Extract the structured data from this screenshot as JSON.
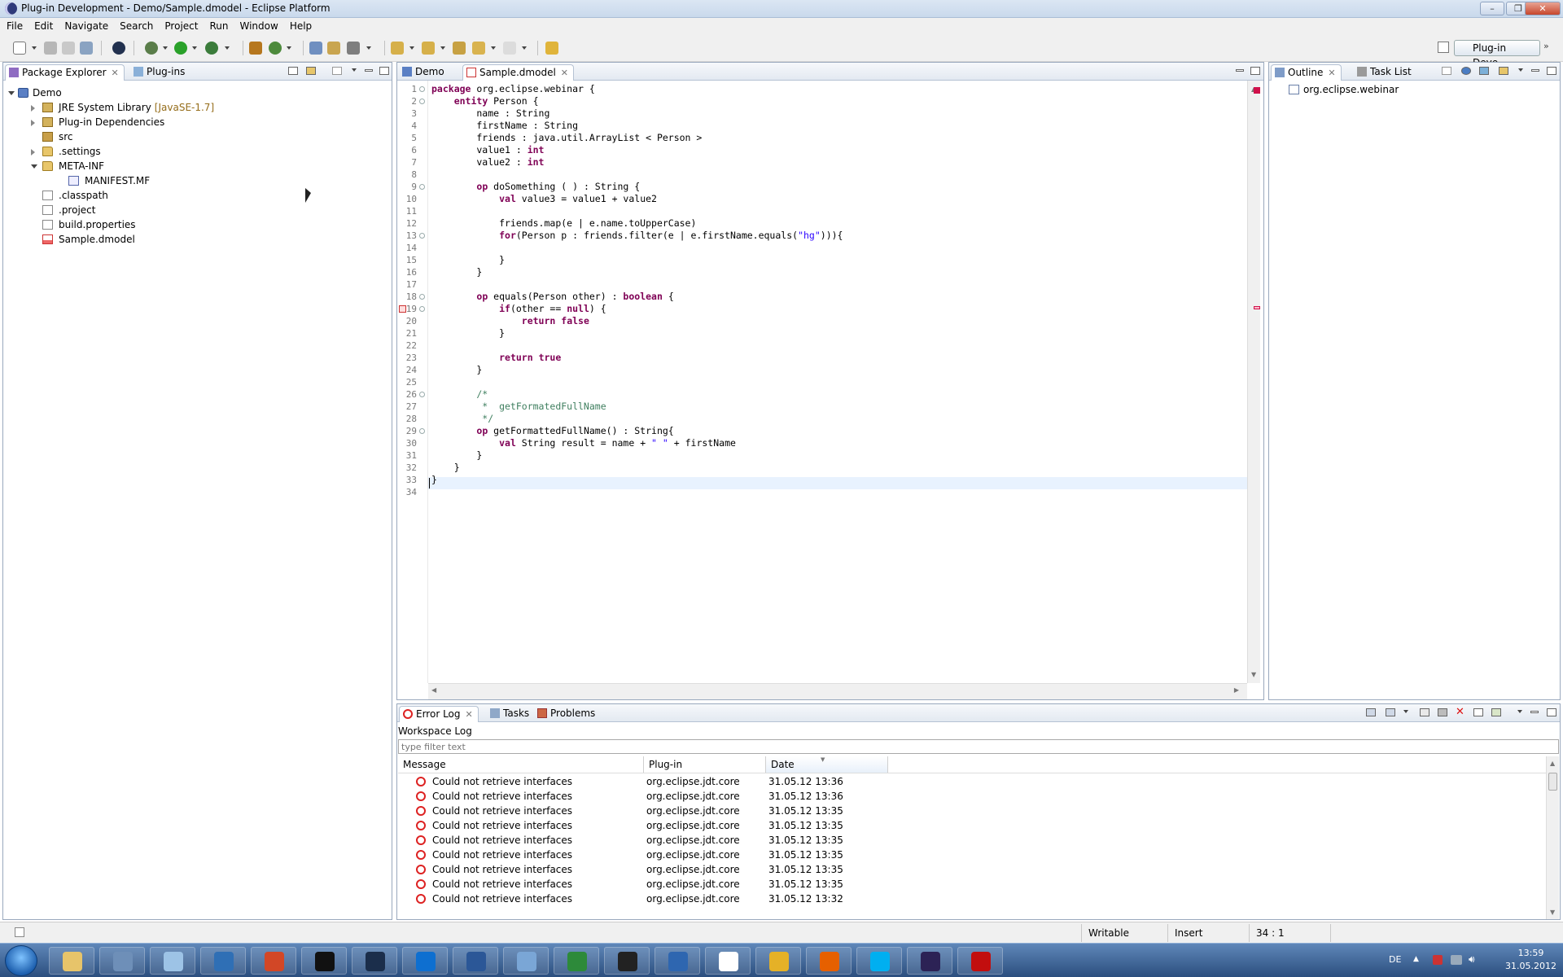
{
  "window": {
    "title": "Plug-in Development - Demo/Sample.dmodel - Eclipse Platform"
  },
  "menu": [
    "File",
    "Edit",
    "Navigate",
    "Search",
    "Project",
    "Run",
    "Window",
    "Help"
  ],
  "perspective": {
    "label": "Plug-in Deve..."
  },
  "left_panel": {
    "tabs": [
      {
        "label": "Package Explorer",
        "active": true
      },
      {
        "label": "Plug-ins",
        "active": false
      }
    ],
    "tree": [
      {
        "label": "Demo",
        "depth": 0,
        "expanded": "down",
        "icon": "project-icon"
      },
      {
        "label": "JRE System Library",
        "suffix": "[JavaSE-1.7]",
        "depth": 1,
        "expanded": "right",
        "icon": "library-icon"
      },
      {
        "label": "Plug-in Dependencies",
        "depth": 1,
        "expanded": "right",
        "icon": "library-icon"
      },
      {
        "label": "src",
        "depth": 1,
        "expanded": "none",
        "icon": "package-folder-icon"
      },
      {
        "label": ".settings",
        "depth": 1,
        "expanded": "right",
        "icon": "folder-icon"
      },
      {
        "label": "META-INF",
        "depth": 1,
        "expanded": "down",
        "icon": "folder-icon"
      },
      {
        "label": "MANIFEST.MF",
        "depth": 2,
        "expanded": "none",
        "icon": "manifest-icon"
      },
      {
        "label": ".classpath",
        "depth": 1,
        "expanded": "none",
        "icon": "file-icon"
      },
      {
        "label": ".project",
        "depth": 1,
        "expanded": "none",
        "icon": "file-icon"
      },
      {
        "label": "build.properties",
        "depth": 1,
        "expanded": "none",
        "icon": "file-icon"
      },
      {
        "label": "Sample.dmodel",
        "depth": 1,
        "expanded": "none",
        "icon": "dmodel-file-icon"
      }
    ]
  },
  "editor": {
    "tabs": [
      {
        "label": "Demo",
        "active": false
      },
      {
        "label": "Sample.dmodel",
        "active": true
      }
    ],
    "lines": [
      [
        [
          "kw",
          "package"
        ],
        [
          "t",
          " org.eclipse.webinar {"
        ]
      ],
      [
        [
          "t",
          "    "
        ],
        [
          "kw",
          "entity"
        ],
        [
          "t",
          " Person {"
        ]
      ],
      [
        [
          "t",
          "        name : String"
        ]
      ],
      [
        [
          "t",
          "        firstName : String"
        ]
      ],
      [
        [
          "t",
          "        friends : java.util.ArrayList < Person >"
        ]
      ],
      [
        [
          "t",
          "        value1 : "
        ],
        [
          "kw",
          "int"
        ]
      ],
      [
        [
          "t",
          "        value2 : "
        ],
        [
          "kw",
          "int"
        ]
      ],
      [
        [
          "t",
          ""
        ]
      ],
      [
        [
          "t",
          "        "
        ],
        [
          "kw",
          "op"
        ],
        [
          "t",
          " doSomething ( ) : String {"
        ]
      ],
      [
        [
          "t",
          "            "
        ],
        [
          "kw",
          "val"
        ],
        [
          "t",
          " value3 = value1 + value2"
        ]
      ],
      [
        [
          "t",
          ""
        ]
      ],
      [
        [
          "t",
          "            friends.map(e | e.name.toUpperCase)"
        ]
      ],
      [
        [
          "t",
          "            "
        ],
        [
          "kw",
          "for"
        ],
        [
          "t",
          "(Person p : friends.filter(e | e.firstName.equals("
        ],
        [
          "str",
          "\"hg\""
        ],
        [
          "t",
          "))){"
        ]
      ],
      [
        [
          "t",
          ""
        ]
      ],
      [
        [
          "t",
          "            }"
        ]
      ],
      [
        [
          "t",
          "        }"
        ]
      ],
      [
        [
          "t",
          ""
        ]
      ],
      [
        [
          "t",
          "        "
        ],
        [
          "kw",
          "op"
        ],
        [
          "t",
          " equals(Person other) : "
        ],
        [
          "kw",
          "boolean"
        ],
        [
          "t",
          " {"
        ]
      ],
      [
        [
          "t",
          "            "
        ],
        [
          "kw",
          "if"
        ],
        [
          "t",
          "(other == "
        ],
        [
          "kw",
          "null"
        ],
        [
          "t",
          ") {"
        ]
      ],
      [
        [
          "t",
          "                "
        ],
        [
          "kw",
          "return"
        ],
        [
          "t",
          " "
        ],
        [
          "kw",
          "false"
        ]
      ],
      [
        [
          "t",
          "            }"
        ]
      ],
      [
        [
          "t",
          ""
        ]
      ],
      [
        [
          "t",
          "            "
        ],
        [
          "kw",
          "return"
        ],
        [
          "t",
          " "
        ],
        [
          "kw",
          "true"
        ]
      ],
      [
        [
          "t",
          "        }"
        ]
      ],
      [
        [
          "t",
          ""
        ]
      ],
      [
        [
          "cm",
          "        /*"
        ]
      ],
      [
        [
          "cm",
          "         *  getFormatedFullName"
        ]
      ],
      [
        [
          "cm",
          "         */"
        ]
      ],
      [
        [
          "t",
          "        "
        ],
        [
          "kw",
          "op"
        ],
        [
          "t",
          " getFormattedFullName() : String{"
        ]
      ],
      [
        [
          "t",
          "            "
        ],
        [
          "kw",
          "val"
        ],
        [
          "t",
          " String result = name + "
        ],
        [
          "str",
          "\" \""
        ],
        [
          "t",
          " + firstName"
        ]
      ],
      [
        [
          "t",
          "        }"
        ]
      ],
      [
        [
          "t",
          "    }"
        ]
      ],
      [
        [
          "t",
          "}"
        ]
      ],
      [
        [
          "t",
          ""
        ]
      ]
    ],
    "fold_lines": [
      1,
      2,
      9,
      13,
      18,
      19,
      26,
      29
    ]
  },
  "outline": {
    "tabs": [
      {
        "label": "Outline",
        "active": true
      },
      {
        "label": "Task List",
        "active": false
      }
    ],
    "items": [
      "org.eclipse.webinar"
    ]
  },
  "bottom": {
    "tabs": [
      {
        "label": "Error Log",
        "active": true
      },
      {
        "label": "Tasks",
        "active": false
      },
      {
        "label": "Problems",
        "active": false
      }
    ],
    "workspace_label": "Workspace Log",
    "filter_placeholder": "type filter text",
    "columns": [
      "Message",
      "Plug-in",
      "Date"
    ],
    "rows": [
      [
        "Could not retrieve interfaces",
        "org.eclipse.jdt.core",
        "31.05.12 13:36"
      ],
      [
        "Could not retrieve interfaces",
        "org.eclipse.jdt.core",
        "31.05.12 13:36"
      ],
      [
        "Could not retrieve interfaces",
        "org.eclipse.jdt.core",
        "31.05.12 13:35"
      ],
      [
        "Could not retrieve interfaces",
        "org.eclipse.jdt.core",
        "31.05.12 13:35"
      ],
      [
        "Could not retrieve interfaces",
        "org.eclipse.jdt.core",
        "31.05.12 13:35"
      ],
      [
        "Could not retrieve interfaces",
        "org.eclipse.jdt.core",
        "31.05.12 13:35"
      ],
      [
        "Could not retrieve interfaces",
        "org.eclipse.jdt.core",
        "31.05.12 13:35"
      ],
      [
        "Could not retrieve interfaces",
        "org.eclipse.jdt.core",
        "31.05.12 13:35"
      ],
      [
        "Could not retrieve interfaces",
        "org.eclipse.jdt.core",
        "31.05.12 13:32"
      ]
    ]
  },
  "status": {
    "writable": "Writable",
    "insert": "Insert",
    "position": "34 : 1"
  },
  "taskbar": {
    "lang": "DE",
    "time": "13:59",
    "date": "31.05.2012",
    "apps": [
      {
        "name": "explorer-icon",
        "color": "#e7c46a"
      },
      {
        "name": "calculator-icon",
        "color": "#6e8fb8"
      },
      {
        "name": "notepad-icon",
        "color": "#9dc3e6"
      },
      {
        "name": "thunderbird-icon",
        "color": "#2f6fb5"
      },
      {
        "name": "powerpoint-icon",
        "color": "#d24726"
      },
      {
        "name": "cmd-icon",
        "color": "#111111"
      },
      {
        "name": "mysql-icon",
        "color": "#1b2e4b"
      },
      {
        "name": "teamviewer-icon",
        "color": "#0e6fd0"
      },
      {
        "name": "word-icon",
        "color": "#2b5797"
      },
      {
        "name": "network-icon",
        "color": "#7aa6d6"
      },
      {
        "name": "green-app-icon",
        "color": "#2d8a3a"
      },
      {
        "name": "xming-icon",
        "color": "#222222"
      },
      {
        "name": "powershell-icon",
        "color": "#2e66b0"
      },
      {
        "name": "amazon-icon",
        "color": "#ffffff"
      },
      {
        "name": "chrome-icon",
        "color": "#e5b127"
      },
      {
        "name": "firefox-icon",
        "color": "#e66000"
      },
      {
        "name": "skype-icon",
        "color": "#00aff0"
      },
      {
        "name": "eclipse-icon",
        "color": "#2c2255"
      },
      {
        "name": "acrobat-icon",
        "color": "#c20e0e"
      }
    ]
  }
}
